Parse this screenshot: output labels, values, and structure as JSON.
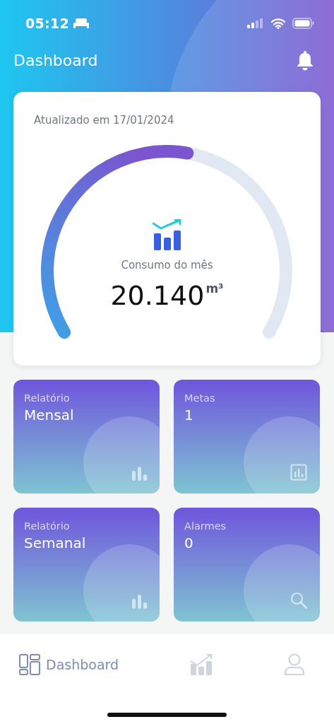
{
  "status_bar": {
    "time": "05:12"
  },
  "header": {
    "title": "Dashboard"
  },
  "gauge_card": {
    "updated": "Atualizado em 17/01/2024",
    "label": "Consumo do mês",
    "value": "20.140",
    "unit": "m³"
  },
  "tiles": [
    {
      "label": "Relatório",
      "value": "Mensal",
      "kind": "bars"
    },
    {
      "label": "Metas",
      "value": "1",
      "kind": "report"
    },
    {
      "label": "Relatório",
      "value": "Semanal",
      "kind": "bars"
    },
    {
      "label": "Alarmes",
      "value": "0",
      "kind": "search"
    }
  ],
  "nav": [
    {
      "kind": "dashboard",
      "label": "Dashboard",
      "selected": true
    },
    {
      "kind": "chart",
      "selected": false
    },
    {
      "kind": "profile",
      "selected": false
    }
  ]
}
